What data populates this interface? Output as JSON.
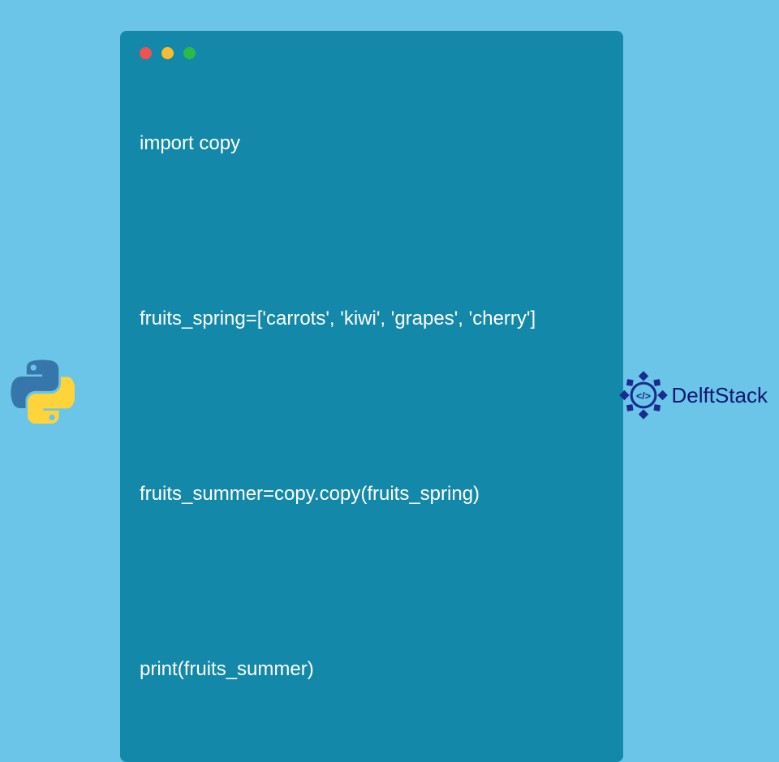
{
  "code": {
    "line1": "import copy",
    "line2": "",
    "line3": "fruits_spring=['carrots', 'kiwi', 'grapes', 'cherry']",
    "line4": "",
    "line5": "fruits_summer=copy.copy(fruits_spring)",
    "line6": "",
    "line7": "print(fruits_summer)"
  },
  "brand": {
    "name": "DelftStack"
  },
  "colors": {
    "background": "#6ac5e8",
    "codeWindow": "#1488a8",
    "brandText": "#0f1570"
  }
}
